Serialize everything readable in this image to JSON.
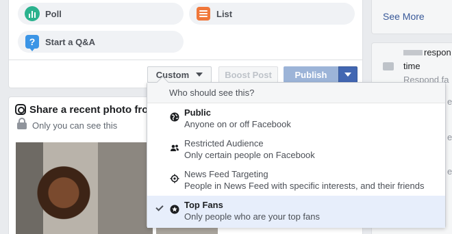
{
  "composer": {
    "options": {
      "poll": "Poll",
      "list": "List",
      "qa": "Start a Q&A"
    },
    "actions": {
      "custom": "Custom",
      "boost": "Boost Post",
      "publish": "Publish"
    }
  },
  "photo_card": {
    "title": "Share a recent photo fro",
    "privacy": "Only you can see this"
  },
  "sidebar": {
    "see_more": "See More",
    "line1": "respon",
    "line2": "time",
    "line3": "Respond fa",
    "line4": "es",
    "line5": "es",
    "line6": "es"
  },
  "audience": {
    "header": "Who should see this?",
    "options": [
      {
        "title": "Public",
        "subtitle": "Anyone on or off Facebook",
        "icon": "globe-icon"
      },
      {
        "title": "Restricted Audience",
        "subtitle": "Only certain people on Facebook",
        "icon": "people-icon"
      },
      {
        "title": "News Feed Targeting",
        "subtitle": "People in News Feed with specific interests, and their friends",
        "icon": "target-icon"
      },
      {
        "title": "Top Fans",
        "subtitle": "Only people who are your top fans",
        "icon": "star-badge-icon",
        "selected": true
      }
    ]
  },
  "colors": {
    "accent": "#4267b2",
    "publish_disabled": "#9cb4d8",
    "selected_row": "#e7eefb",
    "background": "#e9ebee"
  }
}
